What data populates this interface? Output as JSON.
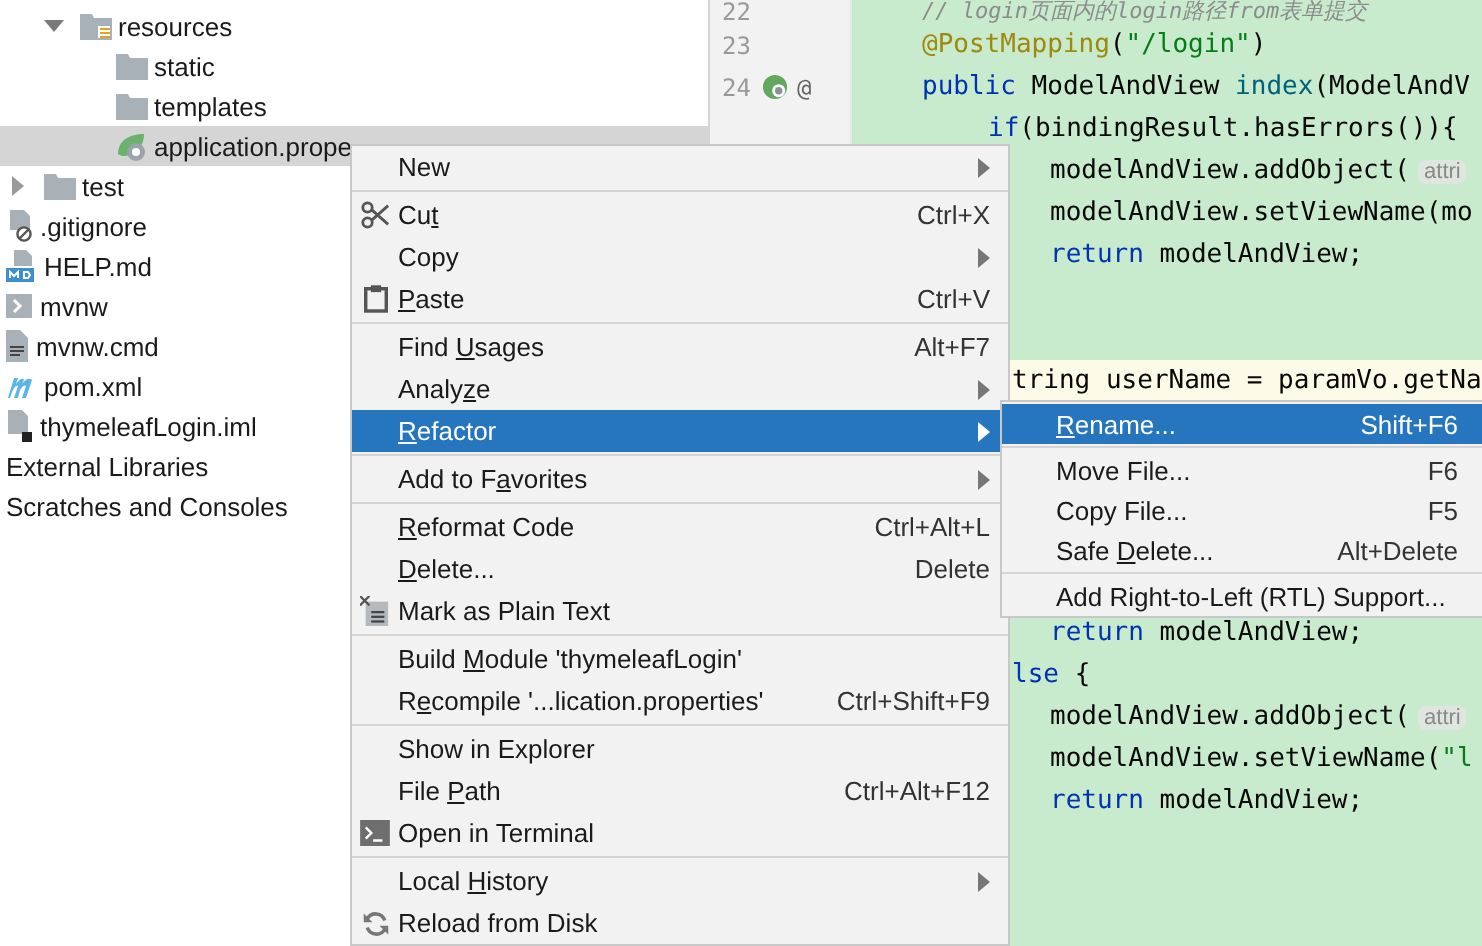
{
  "project_tree": {
    "open_folder": {
      "label": "resources",
      "kind": "resources-folder",
      "expanded": true,
      "selected": false,
      "children": [
        {
          "label": "static",
          "kind": "folder",
          "selected": false
        },
        {
          "label": "templates",
          "kind": "folder",
          "selected": false
        },
        {
          "label": "application.prope",
          "kind": "spring-file",
          "selected": true
        }
      ]
    },
    "items": [
      {
        "label": "test",
        "kind": "folder",
        "expanded": false,
        "selected": false
      },
      {
        "label": ".gitignore",
        "kind": "ignored-file",
        "selected": false
      },
      {
        "label": "HELP.md",
        "kind": "markdown-file",
        "selected": false
      },
      {
        "label": "mvnw",
        "kind": "script-file",
        "selected": false
      },
      {
        "label": "mvnw.cmd",
        "kind": "text-file",
        "selected": false
      },
      {
        "label": "pom.xml",
        "kind": "maven-file",
        "selected": false
      },
      {
        "label": "thymeleafLogin.iml",
        "kind": "module-file",
        "selected": false
      },
      {
        "label": "External Libraries",
        "kind": "group",
        "selected": false
      },
      {
        "label": "Scratches and Consoles",
        "kind": "group",
        "selected": false
      }
    ]
  },
  "editor": {
    "lines": [
      {
        "number": "22",
        "kind": "level0",
        "current": false,
        "parts": [
          {
            "kind": "comment",
            "text": "// login页面内的login路径from表单提交"
          }
        ]
      },
      {
        "number": "23",
        "kind": "level0",
        "current": false,
        "parts": [
          {
            "kind": "annotation",
            "text": "@PostMapping"
          },
          {
            "kind": "plain",
            "text": "("
          },
          {
            "kind": "string",
            "text": "\"/login\""
          },
          {
            "kind": "plain",
            "text": ")"
          }
        ]
      },
      {
        "number": "24",
        "kind": "level0",
        "current": false,
        "gutter": {
          "kind": "bean",
          "text": "@"
        },
        "parts": [
          {
            "kind": "keyword",
            "text": "public "
          },
          {
            "kind": "plain",
            "text": "ModelAndView "
          },
          {
            "kind": "method",
            "text": "index"
          },
          {
            "kind": "plain",
            "text": "(ModelAndV"
          }
        ]
      },
      {
        "kind": "level1",
        "current": false,
        "parts": [
          {
            "kind": "keyword",
            "text": "if"
          },
          {
            "kind": "plain",
            "text": "(bindingResult.hasErrors()){"
          }
        ]
      },
      {
        "kind": "level2",
        "current": false,
        "parts": [
          {
            "kind": "plain",
            "text": "modelAndView.addObject("
          },
          {
            "kind": "hint",
            "text": "attri"
          }
        ]
      },
      {
        "kind": "level2",
        "current": false,
        "parts": [
          {
            "kind": "plain",
            "text": "modelAndView.setViewName(mo"
          }
        ]
      },
      {
        "kind": "level2",
        "current": false,
        "parts": [
          {
            "kind": "keyword",
            "text": "return "
          },
          {
            "kind": "plain",
            "text": "modelAndView;"
          }
        ]
      },
      {
        "kind": "blank"
      },
      {
        "kind": "blank"
      },
      {
        "kind": "after-menu",
        "current": true,
        "parts": [
          {
            "kind": "plain",
            "text": "tring userName = paramVo.getNa"
          }
        ]
      },
      {
        "kind": "blank"
      },
      {
        "kind": "blank"
      },
      {
        "kind": "blank"
      },
      {
        "kind": "blank"
      },
      {
        "kind": "blank"
      },
      {
        "kind": "level2",
        "current": false,
        "parts": [
          {
            "kind": "keyword",
            "text": "return "
          },
          {
            "kind": "plain",
            "text": "modelAndView;"
          }
        ]
      },
      {
        "kind": "after-menu",
        "current": false,
        "parts": [
          {
            "kind": "keyword",
            "text": "lse "
          },
          {
            "kind": "plain",
            "text": "{"
          }
        ]
      },
      {
        "kind": "level2",
        "current": false,
        "parts": [
          {
            "kind": "plain",
            "text": "modelAndView.addObject("
          },
          {
            "kind": "hint",
            "text": "attri"
          }
        ]
      },
      {
        "kind": "level2",
        "current": false,
        "parts": [
          {
            "kind": "plain",
            "text": "modelAndView.setViewName("
          },
          {
            "kind": "string",
            "text": "\"l"
          }
        ]
      },
      {
        "kind": "level2",
        "current": false,
        "parts": [
          {
            "kind": "keyword",
            "text": "return "
          },
          {
            "kind": "plain",
            "text": "modelAndView;"
          }
        ]
      }
    ]
  },
  "context_menu": {
    "groups": [
      [
        {
          "label": "New",
          "submenu": true,
          "selected": false
        }
      ],
      [
        {
          "before": "Cu",
          "mnemonic": "t",
          "kind": "cut",
          "shortcut": "Ctrl+X",
          "submenu": false,
          "selected": false
        },
        {
          "label": "Copy",
          "submenu": true,
          "selected": false
        },
        {
          "mnemonic": "P",
          "after": "aste",
          "kind": "paste",
          "shortcut": "Ctrl+V",
          "submenu": false,
          "selected": false
        }
      ],
      [
        {
          "before": "Find ",
          "mnemonic": "U",
          "after": "sages",
          "shortcut": "Alt+F7",
          "submenu": false,
          "selected": false
        },
        {
          "before": "Analy",
          "mnemonic": "z",
          "after": "e",
          "submenu": true,
          "selected": false
        },
        {
          "mnemonic": "R",
          "after": "efactor",
          "submenu": true,
          "selected": true
        }
      ],
      [
        {
          "before": "Add to F",
          "mnemonic": "a",
          "after": "vorites",
          "submenu": true,
          "selected": false
        }
      ],
      [
        {
          "mnemonic": "R",
          "after": "eformat Code",
          "shortcut": "Ctrl+Alt+L",
          "submenu": false,
          "selected": false
        },
        {
          "mnemonic": "D",
          "after": "elete...",
          "shortcut": "Delete",
          "submenu": false,
          "selected": false
        },
        {
          "label": "Mark as Plain Text",
          "kind": "mark-plain",
          "submenu": false,
          "selected": false
        }
      ],
      [
        {
          "before": "Build ",
          "mnemonic": "M",
          "after": "odule 'thymeleafLogin'",
          "submenu": false,
          "selected": false
        },
        {
          "before": "R",
          "mnemonic": "e",
          "after": "compile '...lication.properties'",
          "shortcut": "Ctrl+Shift+F9",
          "submenu": false,
          "selected": false
        }
      ],
      [
        {
          "label": "Show in Explorer",
          "submenu": false,
          "selected": false
        },
        {
          "before": "File ",
          "mnemonic": "P",
          "after": "ath",
          "shortcut": "Ctrl+Alt+F12",
          "submenu": false,
          "selected": false
        },
        {
          "label": "Open in Terminal",
          "kind": "terminal",
          "submenu": false,
          "selected": false
        }
      ],
      [
        {
          "before": "Local ",
          "mnemonic": "H",
          "after": "istory",
          "submenu": true,
          "selected": false
        },
        {
          "label": "Reload from Disk",
          "kind": "reload",
          "submenu": false,
          "selected": false
        }
      ]
    ]
  },
  "submenu": {
    "groups": [
      [
        {
          "mnemonic": "R",
          "after": "ename...",
          "shortcut": "Shift+F6",
          "selected": true
        }
      ],
      [
        {
          "label": "Move File...",
          "shortcut": "F6",
          "selected": false
        },
        {
          "label": "Copy File...",
          "shortcut": "F5",
          "selected": false
        },
        {
          "before": "Safe ",
          "mnemonic": "D",
          "after": "elete...",
          "shortcut": "Alt+Delete",
          "selected": false
        }
      ],
      [
        {
          "label": "Add Right-to-Left (RTL) Support...",
          "selected": false
        }
      ]
    ]
  }
}
